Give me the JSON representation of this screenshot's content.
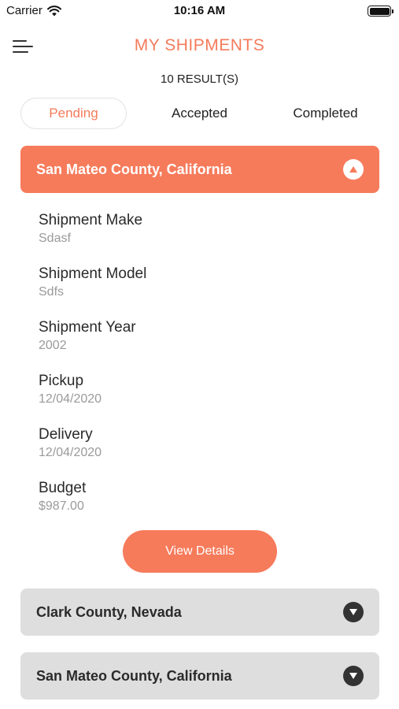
{
  "status_bar": {
    "carrier": "Carrier",
    "time": "10:16 AM",
    "battery_level": 1.0
  },
  "header": {
    "menu_icon": "hamburger-menu-icon",
    "title": "MY SHIPMENTS",
    "result_count": "10 RESULT(S)"
  },
  "tabs": [
    {
      "label": "Pending",
      "active": true
    },
    {
      "label": "Accepted",
      "active": false
    },
    {
      "label": "Completed",
      "active": false
    }
  ],
  "shipments": [
    {
      "title": "San Mateo County, California",
      "expanded": true,
      "toggle_icon": "chevron-up-icon",
      "fields": [
        {
          "label": "Shipment Make",
          "value": "Sdasf"
        },
        {
          "label": "Shipment Model",
          "value": "Sdfs"
        },
        {
          "label": "Shipment Year",
          "value": "2002"
        },
        {
          "label": "Pickup",
          "value": "12/04/2020"
        },
        {
          "label": "Delivery",
          "value": "12/04/2020"
        },
        {
          "label": "Budget",
          "value": "$987.00"
        }
      ],
      "button_label": "View Details"
    },
    {
      "title": "Clark County, Nevada",
      "expanded": false,
      "toggle_icon": "chevron-down-icon"
    },
    {
      "title": "San Mateo County, California",
      "expanded": false,
      "toggle_icon": "chevron-down-icon"
    }
  ],
  "colors": {
    "accent": "#f67b5b",
    "title": "#f47b5b",
    "closed_card": "#dedede"
  }
}
